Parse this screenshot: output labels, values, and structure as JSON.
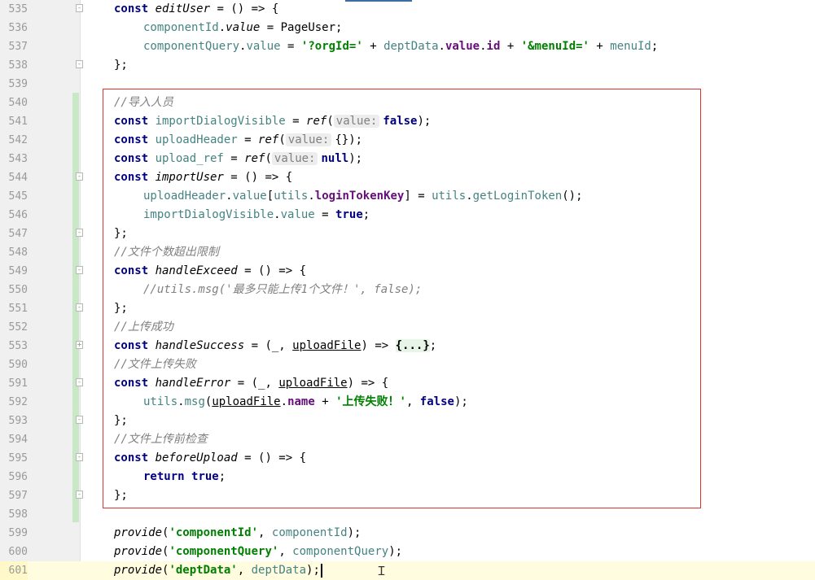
{
  "editor": {
    "current_line": "601",
    "param_hint": "value:",
    "lines": [
      {
        "no": "535",
        "indent": 0,
        "fold": "-",
        "tokens": [
          [
            "kw",
            "const "
          ],
          [
            "fn",
            "editUser"
          ],
          [
            "p",
            " = () => {"
          ]
        ]
      },
      {
        "no": "536",
        "indent": 1,
        "tokens": [
          [
            "var",
            "componentId"
          ],
          [
            "p",
            "."
          ],
          [
            "fn",
            "value"
          ],
          [
            "p",
            " = PageUser;"
          ]
        ]
      },
      {
        "no": "537",
        "indent": 1,
        "tokens": [
          [
            "var",
            "componentQuery"
          ],
          [
            "p",
            "."
          ],
          [
            "var",
            "value"
          ],
          [
            "p",
            " = "
          ],
          [
            "str",
            "'?orgId='"
          ],
          [
            "p",
            " + "
          ],
          [
            "var",
            "deptData"
          ],
          [
            "p",
            "."
          ],
          [
            "prop",
            "value"
          ],
          [
            "p",
            "."
          ],
          [
            "prop",
            "id"
          ],
          [
            "p",
            " + "
          ],
          [
            "str",
            "'&menuId='"
          ],
          [
            "p",
            " + "
          ],
          [
            "var",
            "menuId"
          ],
          [
            "p",
            ";"
          ]
        ]
      },
      {
        "no": "538",
        "indent": 0,
        "fold": "-",
        "tokens": [
          [
            "p",
            "};"
          ]
        ]
      },
      {
        "no": "539",
        "indent": 0,
        "tokens": []
      },
      {
        "no": "540",
        "indent": 0,
        "tokens": [
          [
            "cm",
            "//导入人员"
          ]
        ]
      },
      {
        "no": "541",
        "indent": 0,
        "tokens": [
          [
            "kw",
            "const "
          ],
          [
            "var",
            "importDialogVisible"
          ],
          [
            "p",
            " = "
          ],
          [
            "fn",
            "ref"
          ],
          [
            "p",
            "("
          ],
          [
            "hint",
            "value:"
          ],
          [
            "kw",
            "false"
          ],
          [
            "p",
            ");"
          ]
        ]
      },
      {
        "no": "542",
        "indent": 0,
        "tokens": [
          [
            "kw",
            "const "
          ],
          [
            "var",
            "uploadHeader"
          ],
          [
            "p",
            " = "
          ],
          [
            "fn",
            "ref"
          ],
          [
            "p",
            "("
          ],
          [
            "hint",
            "value:"
          ],
          [
            "p",
            "{});"
          ]
        ]
      },
      {
        "no": "543",
        "indent": 0,
        "tokens": [
          [
            "kw",
            "const "
          ],
          [
            "var",
            "upload_ref"
          ],
          [
            "p",
            " = "
          ],
          [
            "fn",
            "ref"
          ],
          [
            "p",
            "("
          ],
          [
            "hint",
            "value:"
          ],
          [
            "kw",
            "null"
          ],
          [
            "p",
            ");"
          ]
        ]
      },
      {
        "no": "544",
        "indent": 0,
        "fold": "-",
        "tokens": [
          [
            "kw",
            "const "
          ],
          [
            "fn",
            "importUser"
          ],
          [
            "p",
            " = () => {"
          ]
        ]
      },
      {
        "no": "545",
        "indent": 1,
        "tokens": [
          [
            "var",
            "uploadHeader"
          ],
          [
            "p",
            "."
          ],
          [
            "var",
            "value"
          ],
          [
            "p",
            "["
          ],
          [
            "var",
            "utils"
          ],
          [
            "p",
            "."
          ],
          [
            "prop",
            "loginTokenKey"
          ],
          [
            "p",
            "] = "
          ],
          [
            "var",
            "utils"
          ],
          [
            "p",
            "."
          ],
          [
            "var",
            "getLoginToken"
          ],
          [
            "p",
            "();"
          ]
        ]
      },
      {
        "no": "546",
        "indent": 1,
        "tokens": [
          [
            "var",
            "importDialogVisible"
          ],
          [
            "p",
            "."
          ],
          [
            "var",
            "value"
          ],
          [
            "p",
            " = "
          ],
          [
            "kw",
            "true"
          ],
          [
            "p",
            ";"
          ]
        ]
      },
      {
        "no": "547",
        "indent": 0,
        "fold": "-",
        "tokens": [
          [
            "p",
            "};"
          ]
        ]
      },
      {
        "no": "548",
        "indent": 0,
        "tokens": [
          [
            "cm",
            "//文件个数超出限制"
          ]
        ]
      },
      {
        "no": "549",
        "indent": 0,
        "fold": "-",
        "tokens": [
          [
            "kw",
            "const "
          ],
          [
            "fn",
            "handleExceed"
          ],
          [
            "p",
            " = () => {"
          ]
        ]
      },
      {
        "no": "550",
        "indent": 1,
        "tokens": [
          [
            "cm",
            "//utils.msg('最多只能上传1个文件！', false);"
          ]
        ]
      },
      {
        "no": "551",
        "indent": 0,
        "fold": "-",
        "tokens": [
          [
            "p",
            "};"
          ]
        ]
      },
      {
        "no": "552",
        "indent": 0,
        "tokens": [
          [
            "cm",
            "//上传成功"
          ]
        ]
      },
      {
        "no": "553",
        "indent": 0,
        "fold": "+",
        "tokens": [
          [
            "kw",
            "const "
          ],
          [
            "fn",
            "handleSuccess"
          ],
          [
            "p",
            " = (_, "
          ],
          [
            "ul",
            "uploadFile"
          ],
          [
            "p",
            ") => "
          ],
          [
            "foldi",
            "{...}"
          ],
          [
            "p",
            ";"
          ]
        ]
      },
      {
        "no": "590",
        "indent": 0,
        "tokens": [
          [
            "cm",
            "//文件上传失败"
          ]
        ]
      },
      {
        "no": "591",
        "indent": 0,
        "fold": "-",
        "tokens": [
          [
            "kw",
            "const "
          ],
          [
            "fn",
            "handleError"
          ],
          [
            "p",
            " = (_, "
          ],
          [
            "ul",
            "uploadFile"
          ],
          [
            "p",
            ") => {"
          ]
        ]
      },
      {
        "no": "592",
        "indent": 1,
        "tokens": [
          [
            "var",
            "utils"
          ],
          [
            "p",
            "."
          ],
          [
            "var",
            "msg"
          ],
          [
            "p",
            "("
          ],
          [
            "ul",
            "uploadFile"
          ],
          [
            "p",
            "."
          ],
          [
            "prop",
            "name"
          ],
          [
            "p",
            " + "
          ],
          [
            "str",
            "'上传失败！'"
          ],
          [
            "p",
            ", "
          ],
          [
            "kw",
            "false"
          ],
          [
            "p",
            ");"
          ]
        ]
      },
      {
        "no": "593",
        "indent": 0,
        "fold": "-",
        "tokens": [
          [
            "p",
            "};"
          ]
        ]
      },
      {
        "no": "594",
        "indent": 0,
        "tokens": [
          [
            "cm",
            "//文件上传前检查"
          ]
        ]
      },
      {
        "no": "595",
        "indent": 0,
        "fold": "-",
        "tokens": [
          [
            "kw",
            "const "
          ],
          [
            "fn",
            "beforeUpload"
          ],
          [
            "p",
            " = () => {"
          ]
        ]
      },
      {
        "no": "596",
        "indent": 1,
        "tokens": [
          [
            "kw",
            "return "
          ],
          [
            "kw",
            "true"
          ],
          [
            "p",
            ";"
          ]
        ]
      },
      {
        "no": "597",
        "indent": 0,
        "fold": "-",
        "tokens": [
          [
            "p",
            "};"
          ]
        ]
      },
      {
        "no": "598",
        "indent": 0,
        "tokens": []
      },
      {
        "no": "599",
        "indent": 0,
        "tokens": [
          [
            "fn",
            "provide"
          ],
          [
            "p",
            "("
          ],
          [
            "str",
            "'componentId'"
          ],
          [
            "p",
            ", "
          ],
          [
            "var",
            "componentId"
          ],
          [
            "p",
            ");"
          ]
        ]
      },
      {
        "no": "600",
        "indent": 0,
        "tokens": [
          [
            "fn",
            "provide"
          ],
          [
            "p",
            "("
          ],
          [
            "str",
            "'componentQuery'"
          ],
          [
            "p",
            ", "
          ],
          [
            "var",
            "componentQuery"
          ],
          [
            "p",
            ");"
          ]
        ]
      },
      {
        "no": "601",
        "indent": 0,
        "tokens": [
          [
            "fn",
            "provide"
          ],
          [
            "p",
            "("
          ],
          [
            "str",
            "'deptData'"
          ],
          [
            "p",
            ", "
          ],
          [
            "var",
            "deptData"
          ],
          [
            "p",
            ");"
          ]
        ]
      }
    ]
  },
  "colors": {
    "highlight_box": "#e03030",
    "change_bar": "#c9e8c6",
    "keyword": "#000080",
    "string": "#008000",
    "comment": "#808080",
    "variable": "#458383",
    "property": "#660e7a"
  },
  "icons": {
    "fold": "fold-marker-icon",
    "text_cursor": "i-beam-cursor-icon"
  }
}
